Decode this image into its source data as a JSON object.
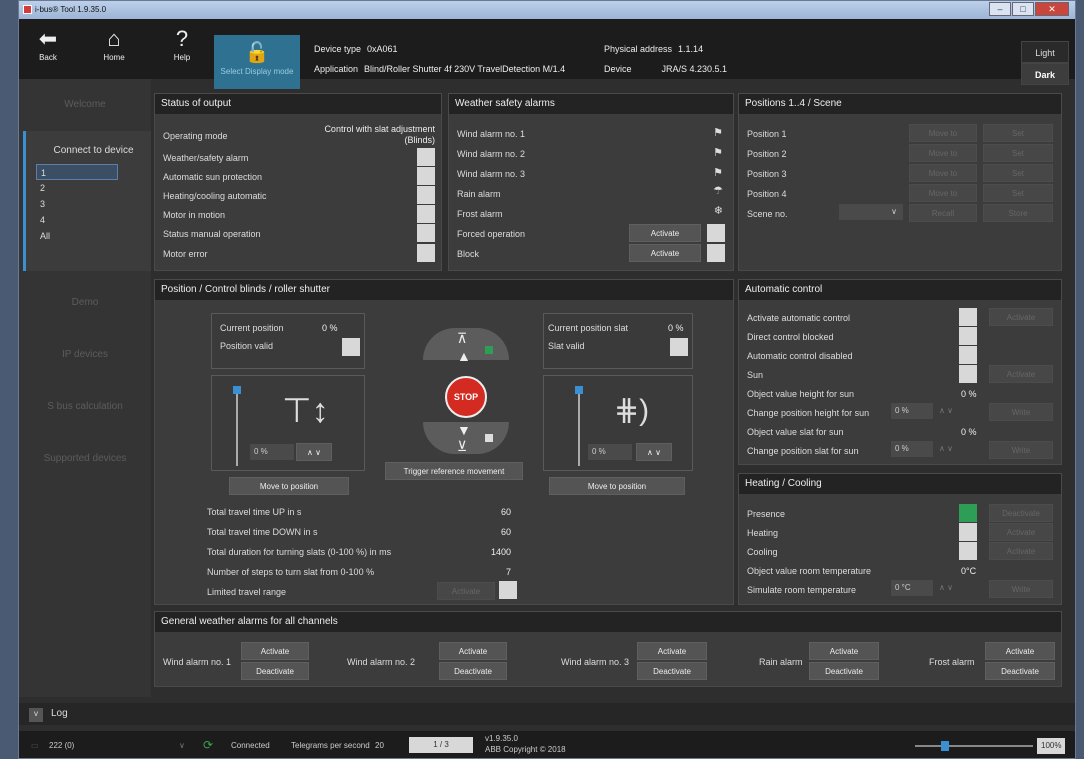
{
  "app": {
    "title": "i-bus® Tool 1.9.35.0"
  },
  "toolbar": {
    "back": "Back",
    "home": "Home",
    "help": "Help",
    "select_display": "Select Display mode"
  },
  "device": {
    "type_label": "Device type",
    "type": "0xA061",
    "app_label": "Application",
    "app": "Blind/Roller Shutter 4f 230V TravelDetection M/1.4",
    "phys_label": "Physical address",
    "phys": "1.1.14",
    "dev_label": "Device",
    "dev": "JRA/S 4.230.5.1"
  },
  "theme": {
    "light": "Light",
    "dark": "Dark"
  },
  "sidebar": {
    "welcome": "Welcome",
    "connect": "Connect to device",
    "channels": [
      "1",
      "2",
      "3",
      "4",
      "All"
    ],
    "demo": "Demo",
    "ip": "IP devices",
    "sbus": "S bus calculation",
    "supported": "Supported devices"
  },
  "status_output": {
    "title": "Status of output",
    "mode_label": "Operating mode",
    "mode_value": "Control with slat adjustment",
    "mode_value2": "(Blinds)",
    "rows": [
      "Weather/safety alarm",
      "Automatic sun protection",
      "Heating/cooling automatic",
      "Motor in motion",
      "Status manual operation",
      "Motor error"
    ]
  },
  "weather": {
    "title": "Weather safety alarms",
    "rows": [
      "Wind alarm no. 1",
      "Wind alarm no. 2",
      "Wind alarm no. 3",
      "Rain alarm",
      "Frost alarm",
      "Forced operation",
      "Block"
    ],
    "activate": "Activate"
  },
  "positions": {
    "title": "Positions 1..4 / Scene",
    "rows": [
      "Position 1",
      "Position 2",
      "Position 3",
      "Position 4"
    ],
    "move": "Move to",
    "set": "Set",
    "scene": "Scene no.",
    "recall": "Recall",
    "store": "Store"
  },
  "posctl": {
    "title": "Position / Control blinds / roller shutter",
    "cur_pos": "Current position",
    "cur_pos_val": "0 %",
    "pos_valid": "Position valid",
    "cur_slat": "Current position slat",
    "cur_slat_val": "0 %",
    "slat_valid": "Slat valid",
    "pos_input": "0 %",
    "slat_input": "0 %",
    "move": "Move to position",
    "trigger": "Trigger reference movement",
    "stop": "STOP",
    "params": [
      [
        "Total travel time UP in s",
        "60"
      ],
      [
        "Total travel time DOWN in s",
        "60"
      ],
      [
        "Total duration for turning slats (0-100 %) in ms",
        "1400"
      ],
      [
        "Number of steps to turn slat from 0-100 %",
        "7"
      ]
    ],
    "limited": "Limited travel range",
    "activate": "Activate"
  },
  "auto": {
    "title": "Automatic control",
    "rows": [
      "Activate automatic control",
      "Direct control blocked",
      "Automatic control disabled",
      "Sun",
      "Object value height for sun",
      "Change position height for sun",
      "Object value slat for sun",
      "Change position slat for sun"
    ],
    "activate": "Activate",
    "write": "Write",
    "height_val": "0 %",
    "slat_val": "0 %",
    "height_in": "0 %",
    "slat_in": "0 %"
  },
  "heat": {
    "title": "Heating / Cooling",
    "rows": [
      "Presence",
      "Heating",
      "Cooling",
      "Object value room temperature",
      "Simulate room temperature"
    ],
    "deactivate": "Deactivate",
    "activate": "Activate",
    "write": "Write",
    "room_val": "0°C",
    "sim_in": "0 °C"
  },
  "general": {
    "title": "General weather alarms for all channels",
    "alarms": [
      "Wind alarm no. 1",
      "Wind alarm no. 2",
      "Wind alarm no. 3",
      "Rain alarm",
      "Frost alarm"
    ],
    "activate": "Activate",
    "deactivate": "Deactivate"
  },
  "log": {
    "label": "Log",
    "toggle": "v"
  },
  "statusbar": {
    "port": "222 (0)",
    "connected": "Connected",
    "tps_label": "Telegrams per second",
    "tps": "20",
    "page": "1 / 3",
    "version": "v1.9.35.0",
    "copyright": "ABB Copyright © 2018",
    "zoom": "100%",
    "zoom_level": 0.25
  }
}
